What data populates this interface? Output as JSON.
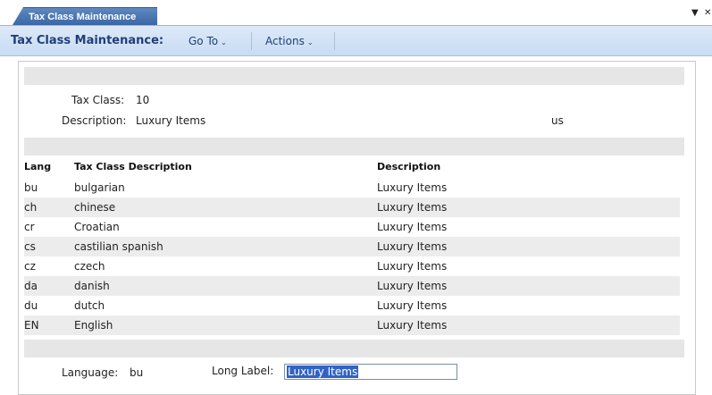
{
  "tab": {
    "title": "Tax Class Maintenance"
  },
  "window": {
    "menu_glyph": "▼",
    "close_glyph": "✕"
  },
  "toolbar": {
    "title": "Tax Class Maintenance:",
    "goto_label": "Go To",
    "actions_label": "Actions",
    "caret": "⌄"
  },
  "header": {
    "tax_class_label": "Tax Class:",
    "tax_class_value": "10",
    "description_label": "Description:",
    "description_value": "Luxury Items",
    "lang_code": "us"
  },
  "table": {
    "columns": [
      "Lang",
      "Tax Class Description",
      "Description"
    ],
    "rows": [
      {
        "lang": "bu",
        "tax_class_description": "bulgarian",
        "description": "Luxury Items"
      },
      {
        "lang": "ch",
        "tax_class_description": "chinese",
        "description": "Luxury Items"
      },
      {
        "lang": "cr",
        "tax_class_description": "Croatian",
        "description": "Luxury Items"
      },
      {
        "lang": "cs",
        "tax_class_description": "castilian spanish",
        "description": "Luxury Items"
      },
      {
        "lang": "cz",
        "tax_class_description": "czech",
        "description": "Luxury Items"
      },
      {
        "lang": "da",
        "tax_class_description": "danish",
        "description": "Luxury Items"
      },
      {
        "lang": "du",
        "tax_class_description": "dutch",
        "description": "Luxury Items"
      },
      {
        "lang": "EN",
        "tax_class_description": "English",
        "description": "Luxury Items"
      }
    ]
  },
  "detail": {
    "language_label": "Language:",
    "language_value": "bu",
    "long_label_label": "Long Label:",
    "long_label_value": "Luxury Items"
  },
  "colors": {
    "accent": "#3a67a5",
    "toolbar_bg": "#c9dcf3",
    "selection": "#3163c5"
  }
}
